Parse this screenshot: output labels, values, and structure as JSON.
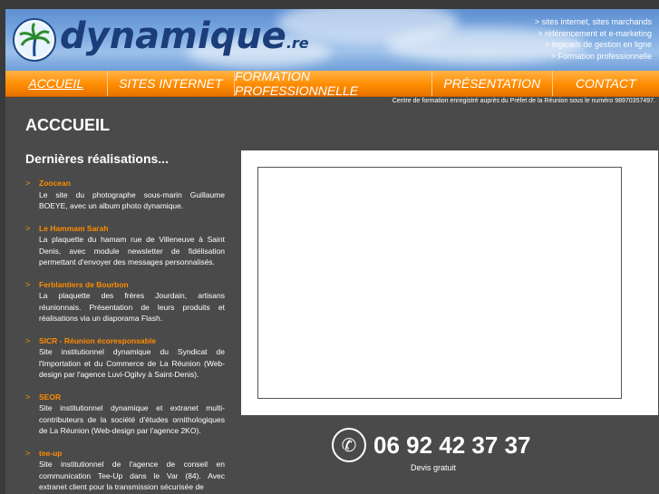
{
  "header": {
    "logo_text": "dynamique",
    "logo_suffix": ".re",
    "taglines": [
      "> sites internet, sites marchands",
      "> référencement et e-marketing",
      "> logiciels de gestion en ligne",
      "> Formation professionnelle"
    ]
  },
  "nav": {
    "items": [
      {
        "label": "ACCUEIL"
      },
      {
        "label": "SITES INTERNET"
      },
      {
        "label": "FORMATION PROFESSIONNELLE"
      },
      {
        "label": "PRÉSENTATION"
      },
      {
        "label": "CONTACT"
      }
    ]
  },
  "notice": "Centre de formation enregistré auprès du Préfet de la Réunion sous le numéro 98970357497.",
  "page_title": "ACCCUEIL",
  "section_title": "Dernières réalisations...",
  "realisations": [
    {
      "title": "Zoocean",
      "text": "Le site du photographe sous-marin Guillaume BOEYE, avec un album photo dynamique."
    },
    {
      "title": "Le Hammam Sarah",
      "text": "La plaquette du hamam rue de Villeneuve à Saint Denis, avec module newsletter de fidélisation permettant d'envoyer des messages personnalisés."
    },
    {
      "title": "Ferblantiers de Bourbon",
      "text": "La plaquette des frères Jourdain, artisans réunionnais. Présentation de leurs produits et réalisations via un diaporama Flash."
    },
    {
      "title": "SICR - Réunion écoresponsable",
      "text": "Site institutionnel dynamique du Syndicat de l'Importation et du Commerce de La Réunion (Web-design par l'agence Luvi-Ogilvy à Saint-Denis)."
    },
    {
      "title": "SEOR",
      "text": "Site institutionnel dynamique et extranet multi-contributeurs de la société d'études ornithologiques de La Réunion (Web-design par l'agence 2KO)."
    },
    {
      "title": "tee-up",
      "text": "Site institutionnel de l'agence de conseil en communication Tee-Up dans le Var (84). Avec extranet client pour la transmission sécurisée de"
    }
  ],
  "bullet": ">",
  "phone": {
    "number": "06 92 42 37 37",
    "icon": "phone-icon",
    "devis": "Devis gratuit"
  }
}
